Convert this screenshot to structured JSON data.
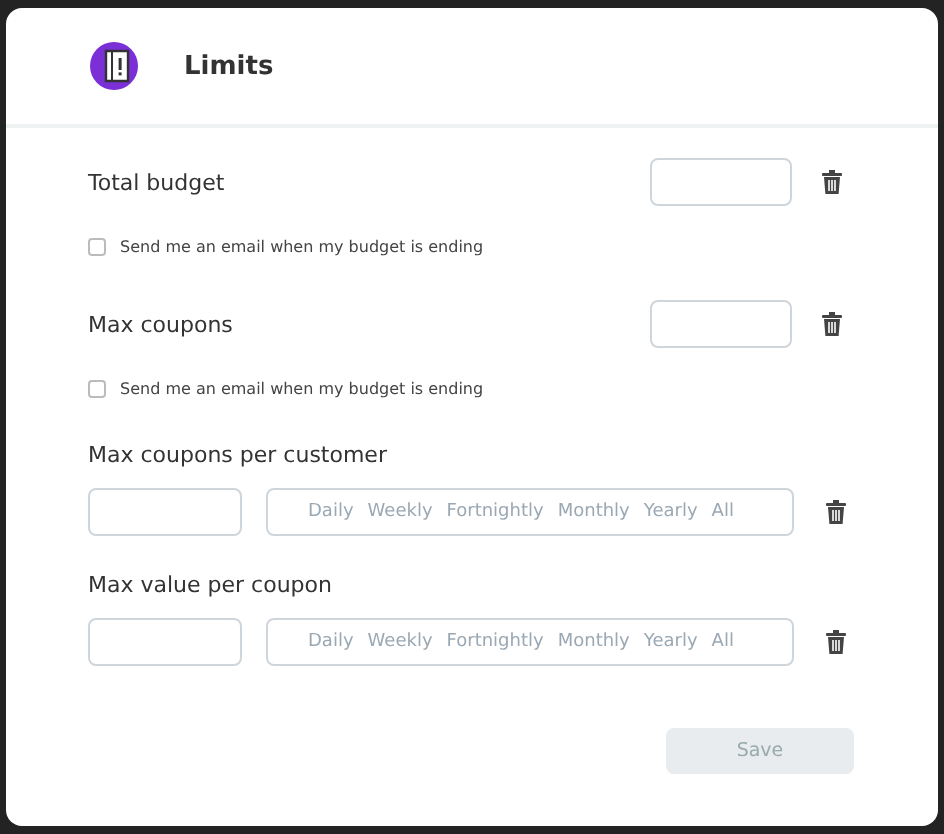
{
  "dialog": {
    "title": "Limits",
    "limits": [
      {
        "kind": "simple",
        "label": "Total budget",
        "notify": {
          "label": "Send me an email when my budget is ending",
          "checked": false
        }
      },
      {
        "kind": "simple",
        "label": "Max coupons",
        "notify": {
          "label": "Send me an email when my budget is ending",
          "checked": false
        }
      },
      {
        "kind": "periodic",
        "label": "Max coupons per customer",
        "periods": [
          {
            "label": "Daily",
            "selected": false
          },
          {
            "label": "Weekly",
            "selected": false
          },
          {
            "label": "Fortnightly",
            "selected": false
          },
          {
            "label": "Monthly",
            "selected": false
          },
          {
            "label": "Yearly",
            "selected": false
          },
          {
            "label": "All",
            "selected": false
          }
        ]
      },
      {
        "kind": "periodic",
        "label": "Max value per coupon",
        "periods": [
          {
            "label": "Daily",
            "selected": false
          },
          {
            "label": "Weekly",
            "selected": false
          },
          {
            "label": "Fortnightly",
            "selected": false
          },
          {
            "label": "Monthly",
            "selected": false
          },
          {
            "label": "Yearly",
            "selected": false
          },
          {
            "label": "All",
            "selected": false
          }
        ]
      }
    ],
    "save_button": {
      "label": "Save",
      "disabled": true
    }
  }
}
